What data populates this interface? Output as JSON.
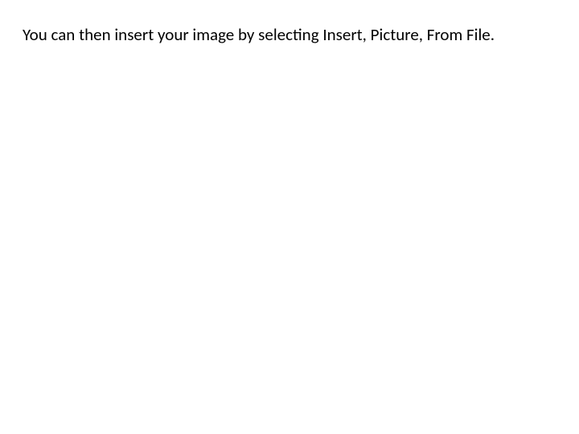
{
  "slide": {
    "body_text": "You can then insert your image by selecting Insert, Picture, From File."
  }
}
